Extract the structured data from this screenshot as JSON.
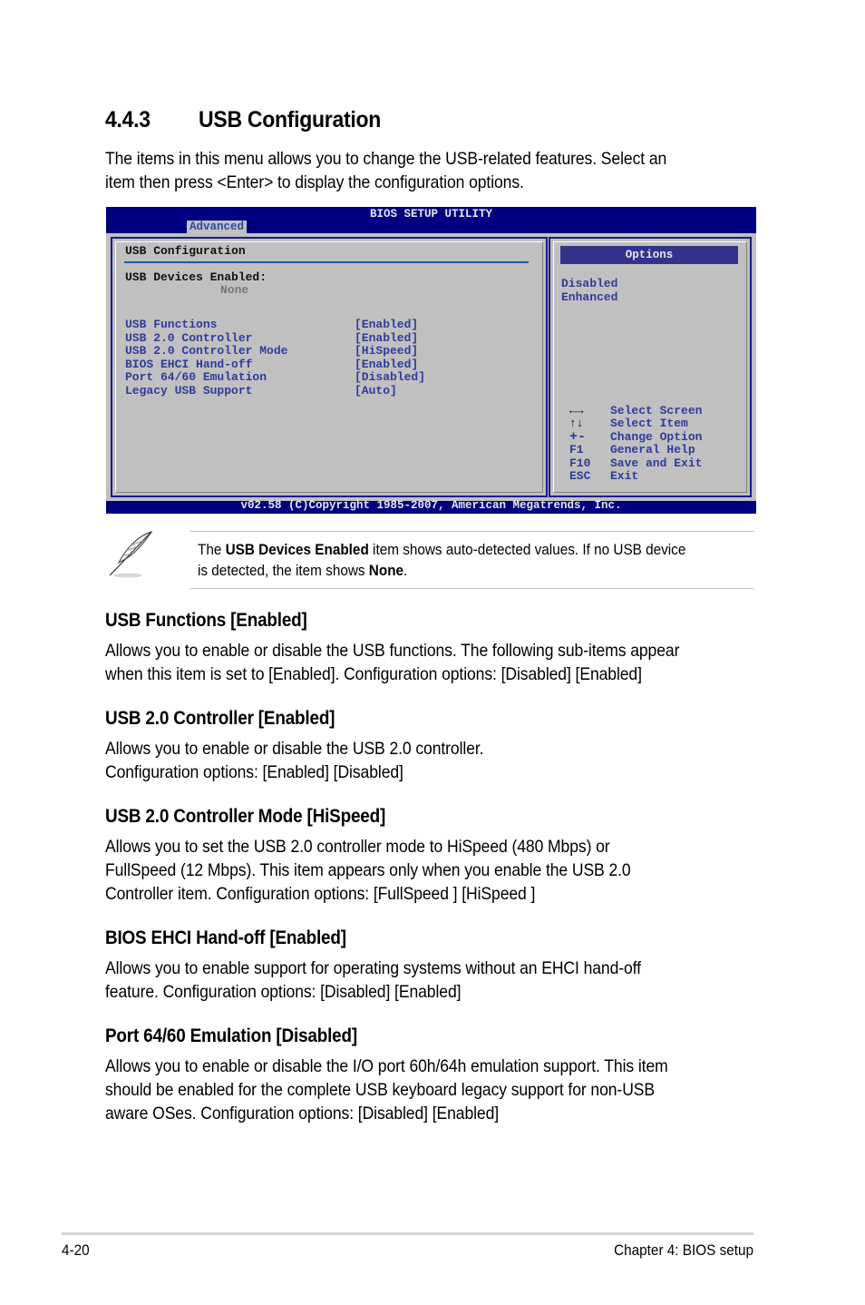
{
  "section": {
    "number": "4.4.3",
    "title": "USB Configuration",
    "intro": [
      "The items in this menu allows you to change the USB-related features. Select an",
      "item then press <Enter> to display the configuration options."
    ]
  },
  "bios": {
    "title": "BIOS SETUP UTILITY",
    "active_tab": "Advanced",
    "left": {
      "title": "USB Configuration",
      "devices_label": "USB Devices Enabled:",
      "devices_value": "None",
      "items": [
        {
          "label": "USB Functions",
          "value": "[Enabled]"
        },
        {
          "label": "USB 2.0 Controller",
          "value": "[Enabled]"
        },
        {
          "label": "USB 2.0 Controller Mode",
          "value": "[HiSpeed]"
        },
        {
          "label": "BIOS EHCI Hand-off",
          "value": "[Enabled]"
        },
        {
          "label": "Port 64/60 Emulation",
          "value": "[Disabled]"
        },
        {
          "label": "Legacy USB Support",
          "value": "[Auto]"
        }
      ]
    },
    "right": {
      "options_header": "Options",
      "options": [
        "Disabled",
        "Enhanced"
      ],
      "keys": [
        {
          "key": "←→",
          "icon": "left-right-arrows-icon",
          "action": "Select Screen"
        },
        {
          "key": "↑↓",
          "icon": "up-down-arrows-icon",
          "action": "Select Item"
        },
        {
          "key": "+-",
          "icon": "plus-minus-icon",
          "action": "Change Option"
        },
        {
          "key": "F1",
          "action": "General Help"
        },
        {
          "key": "F10",
          "action": "Save and Exit"
        },
        {
          "key": "ESC",
          "action": "Exit"
        }
      ]
    },
    "footer": "v02.58 (C)Copyright 1985-2007, American Megatrends, Inc."
  },
  "note": {
    "icon": "feather-pen-icon",
    "pre": "The ",
    "bold1": "USB Devices Enabled",
    "mid": " item shows auto-detected values. If no USB device",
    "line2_pre": "is detected, the item shows ",
    "bold2": "None",
    "line2_post": "."
  },
  "subsections": [
    {
      "heading": "USB Functions [Enabled]",
      "lines": [
        "Allows you to enable or disable the USB functions. The following sub-items appear",
        "when this item is set to [Enabled]. Configuration options: [Disabled] [Enabled]"
      ]
    },
    {
      "heading": "USB 2.0 Controller [Enabled]",
      "lines": [
        "Allows you to enable or disable the USB 2.0 controller.",
        "Configuration options: [Enabled] [Disabled]"
      ]
    },
    {
      "heading": "USB 2.0 Controller Mode [HiSpeed]",
      "lines": [
        "Allows you to set the USB 2.0 controller mode to HiSpeed (480 Mbps) or",
        "FullSpeed (12 Mbps). This item appears only when you enable the USB 2.0",
        "Controller item. Configuration options: [FullSpeed ] [HiSpeed ]"
      ]
    },
    {
      "heading": "BIOS EHCI Hand-off [Enabled]",
      "lines": [
        "Allows you to enable support for operating systems without an EHCI hand-off",
        "feature. Configuration options: [Disabled] [Enabled]"
      ]
    },
    {
      "heading": "Port 64/60 Emulation [Disabled]",
      "lines": [
        "Allows you to enable or disable the I/O port 60h/64h emulation support. This item",
        "should be enabled for the complete USB keyboard legacy support for non-USB",
        "aware OSes. Configuration options: [Disabled] [Enabled]"
      ]
    }
  ],
  "page_footer": {
    "page_number": "4-20",
    "chapter": "Chapter 4: BIOS setup"
  }
}
